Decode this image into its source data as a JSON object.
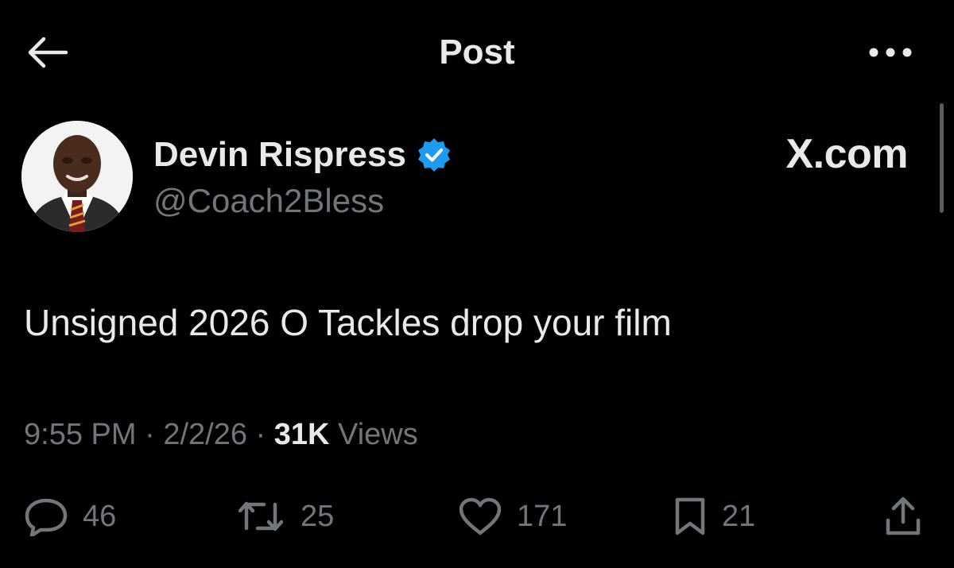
{
  "header": {
    "title": "Post",
    "back_icon": "arrow-left-icon",
    "more_icon": "more-horizontal-icon"
  },
  "post": {
    "author": {
      "display_name": "Devin Rispress",
      "handle": "@Coach2Bless",
      "verified": true,
      "verified_color": "#1d9bf0"
    },
    "source_label": "X.com",
    "text": "Unsigned 2026 O Tackles drop your film",
    "meta": {
      "time": "9:55 PM",
      "separator": " · ",
      "date": "2/2/26",
      "views_count": "31K",
      "views_label": "Views"
    }
  },
  "actions": {
    "replies": {
      "icon": "reply-icon",
      "count": "46"
    },
    "reposts": {
      "icon": "repost-icon",
      "count": "25"
    },
    "likes": {
      "icon": "heart-icon",
      "count": "171"
    },
    "bookmarks": {
      "icon": "bookmark-icon",
      "count": "21"
    },
    "share": {
      "icon": "share-icon"
    }
  },
  "colors": {
    "background": "#000000",
    "primary_text": "#e7e9ea",
    "secondary_text": "#71767b",
    "accent": "#1d9bf0"
  }
}
